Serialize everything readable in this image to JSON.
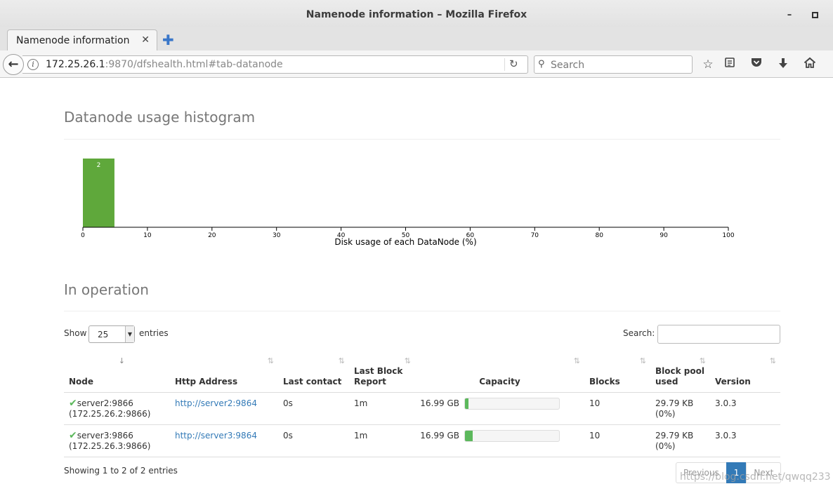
{
  "window": {
    "title": "Namenode information – Mozilla Firefox",
    "minimize": "–"
  },
  "tabs": [
    {
      "label": "Namenode information",
      "close": "✕"
    }
  ],
  "newtab": "✚",
  "nav": {
    "back": "←",
    "url_host": "172.25.26.1",
    "url_rest": ":9870/dfshealth.html#tab-datanode",
    "reload": "↻",
    "search_placeholder": "Search",
    "icons": [
      "bookmark-star-icon",
      "reading-list-icon",
      "pocket-icon",
      "download-icon",
      "home-icon"
    ]
  },
  "histogram": {
    "title": "Datanode usage histogram"
  },
  "chart_data": {
    "type": "bar",
    "xlabel": "Disk usage of each DataNode (%)",
    "xlim": [
      0,
      100
    ],
    "xticks": [
      0,
      10,
      20,
      30,
      40,
      50,
      60,
      70,
      80,
      90,
      100
    ],
    "bins": [
      {
        "from": 0,
        "to": 5,
        "count": 2
      }
    ],
    "bar_color": "#5fa83b"
  },
  "operation": {
    "title": "In operation",
    "show_label": "Show",
    "page_size": "25",
    "entries_label": "entries",
    "search_label": "Search:"
  },
  "table": {
    "columns": [
      {
        "label": "Node",
        "sort": "⇣⇡"
      },
      {
        "label": "Http Address",
        "sort": "⇅"
      },
      {
        "label": "Last contact",
        "sort": "⇅"
      },
      {
        "label": "Last Block Report",
        "sort": "⇅"
      },
      {
        "label": "Capacity",
        "sort": "⇅"
      },
      {
        "label": "Blocks",
        "sort": "⇅"
      },
      {
        "label": "Block pool used",
        "sort": "⇅"
      },
      {
        "label": "Version",
        "sort": "⇅"
      }
    ],
    "rows": [
      {
        "status": "✔",
        "node": "server2:9866",
        "node_ip": "(172.25.26.2:9866)",
        "http": "http://server2:9864",
        "last_contact": "0s",
        "last_block_report": "1m",
        "capacity": "16.99 GB",
        "used_fraction": 0.04,
        "blocks": "10",
        "pool_used": "29.79 KB",
        "pool_pct": "(0%)",
        "version": "3.0.3"
      },
      {
        "status": "✔",
        "node": "server3:9866",
        "node_ip": "(172.25.26.3:9866)",
        "http": "http://server3:9864",
        "last_contact": "0s",
        "last_block_report": "1m",
        "capacity": "16.99 GB",
        "used_fraction": 0.08,
        "blocks": "10",
        "pool_used": "29.79 KB",
        "pool_pct": "(0%)",
        "version": "3.0.3"
      }
    ]
  },
  "footer": {
    "info": "Showing 1 to 2 of 2 entries",
    "prev": "Previous",
    "page": "1",
    "next": "Next"
  },
  "watermark": "https://blog.csdn.net/qwqq233"
}
